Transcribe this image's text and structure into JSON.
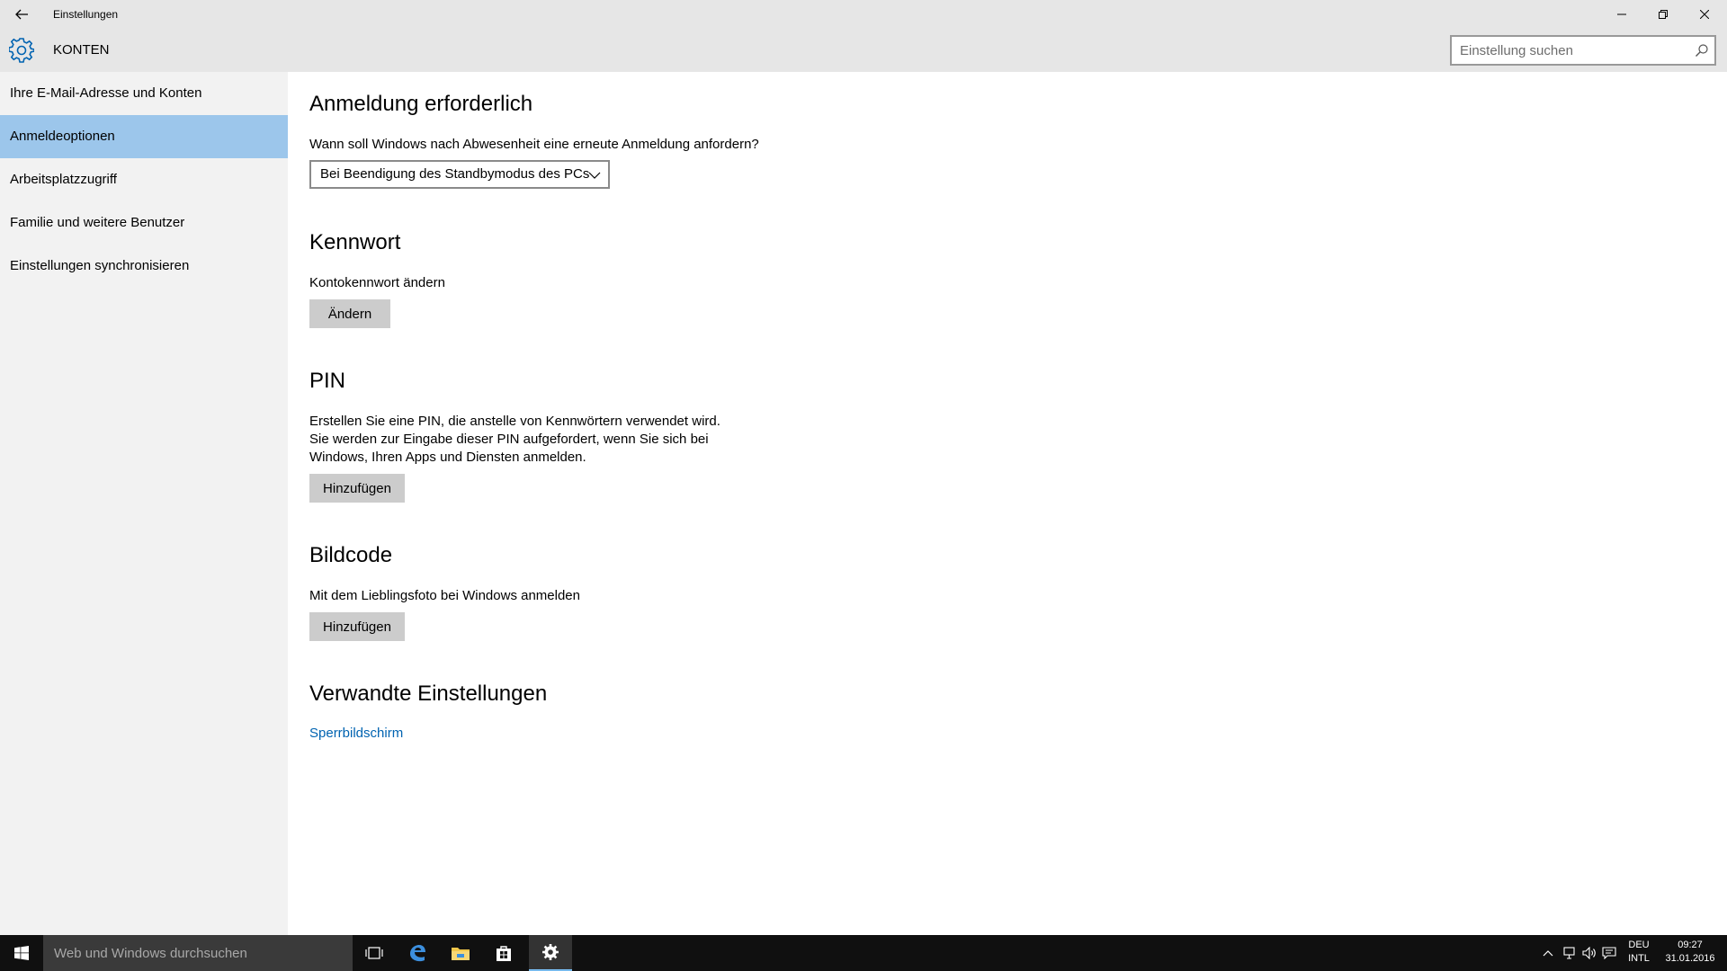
{
  "window": {
    "title": "Einstellungen"
  },
  "header": {
    "app_title": "KONTEN",
    "search_placeholder": "Einstellung suchen"
  },
  "sidebar": {
    "items": [
      {
        "label": "Ihre E-Mail-Adresse und Konten",
        "active": false
      },
      {
        "label": "Anmeldeoptionen",
        "active": true
      },
      {
        "label": "Arbeitsplatzzugriff",
        "active": false
      },
      {
        "label": "Familie und weitere Benutzer",
        "active": false
      },
      {
        "label": "Einstellungen synchronisieren",
        "active": false
      }
    ]
  },
  "main": {
    "signin": {
      "heading": "Anmeldung erforderlich",
      "question": "Wann soll Windows nach Abwesenheit eine erneute Anmeldung anfordern?",
      "select_value": "Bei Beendigung des Standbymodus des PCs"
    },
    "password": {
      "heading": "Kennwort",
      "description": "Kontokennwort ändern",
      "button": "Ändern"
    },
    "pin": {
      "heading": "PIN",
      "line1": "Erstellen Sie eine PIN, die anstelle von Kennwörtern verwendet wird.",
      "line2": "Sie werden zur Eingabe dieser PIN aufgefordert, wenn Sie sich bei",
      "line3": "Windows, Ihren Apps und Diensten anmelden.",
      "button": "Hinzufügen"
    },
    "picture_password": {
      "heading": "Bildcode",
      "description": "Mit dem Lieblingsfoto bei Windows anmelden",
      "button": "Hinzufügen"
    },
    "related": {
      "heading": "Verwandte Einstellungen",
      "link": "Sperrbildschirm"
    }
  },
  "taskbar": {
    "search_placeholder": "Web und Windows durchsuchen",
    "language_line1": "DEU",
    "language_line2": "INTL",
    "time": "09:27",
    "date": "31.01.2016"
  },
  "colors": {
    "accent": "#0063b1",
    "selected_nav": "#9cc6eb",
    "chrome": "#e6e6e6",
    "sidebar": "#f2f2f2",
    "taskbar": "#101010"
  }
}
